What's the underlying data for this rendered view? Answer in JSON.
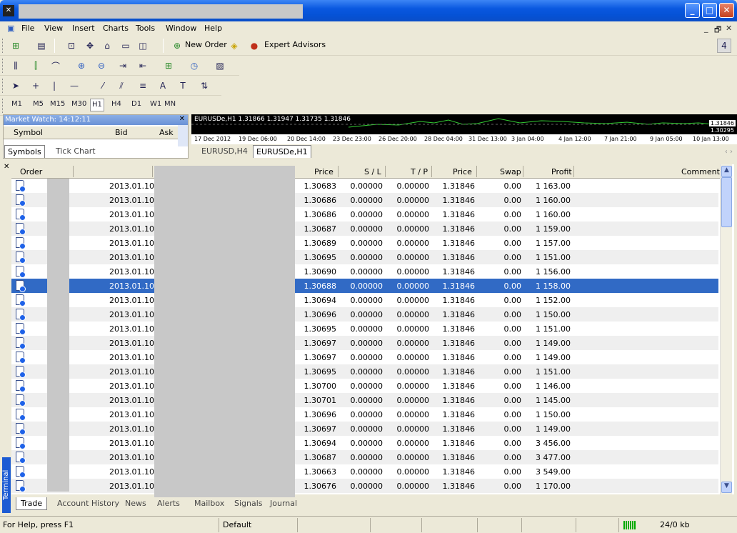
{
  "menu": [
    "File",
    "View",
    "Insert",
    "Charts",
    "Tools",
    "Window",
    "Help"
  ],
  "toolbar": {
    "new_order": "New Order",
    "expert_advisors": "Expert Advisors",
    "text_tool": "A"
  },
  "timeframes": [
    "M1",
    "M5",
    "M15",
    "M30",
    "H1",
    "H4",
    "D1",
    "W1",
    "MN"
  ],
  "market_watch": {
    "title": "Market Watch: 14:12:11",
    "col_symbol": "Symbol",
    "col_bid": "Bid",
    "col_ask": "Ask",
    "tabs": [
      "Symbols",
      "Tick Chart"
    ]
  },
  "chart": {
    "header": "EURUSDe,H1  1.31866 1.31947 1.31735 1.31846",
    "price_high": "1.31846",
    "price_low": "1.30295",
    "time_labels": [
      "17 Dec 2012",
      "19 Dec 06:00",
      "20 Dec 14:00",
      "23 Dec 23:00",
      "26 Dec 20:00",
      "28 Dec 04:00",
      "31 Dec 13:00",
      "3 Jan 04:00",
      "4 Jan 12:00",
      "7 Jan 21:00",
      "9 Jan 05:00",
      "10 Jan 13:00"
    ],
    "tabs": [
      "EURUSD,H4",
      "EURUSDe,H1"
    ]
  },
  "terminal": {
    "label": "Terminal",
    "columns": {
      "order": "Order",
      "price": "Price",
      "sl": "S / L",
      "tp": "T / P",
      "price2": "Price",
      "swap": "Swap",
      "profit": "Profit",
      "comment": "Comment"
    },
    "rows": [
      {
        "date": "2013.01.10",
        "price": "1.30683",
        "sl": "0.00000",
        "tp": "0.00000",
        "cur": "1.31846",
        "swap": "0.00",
        "profit": "1 163.00"
      },
      {
        "date": "2013.01.10",
        "price": "1.30686",
        "sl": "0.00000",
        "tp": "0.00000",
        "cur": "1.31846",
        "swap": "0.00",
        "profit": "1 160.00"
      },
      {
        "date": "2013.01.10",
        "price": "1.30686",
        "sl": "0.00000",
        "tp": "0.00000",
        "cur": "1.31846",
        "swap": "0.00",
        "profit": "1 160.00"
      },
      {
        "date": "2013.01.10",
        "price": "1.30687",
        "sl": "0.00000",
        "tp": "0.00000",
        "cur": "1.31846",
        "swap": "0.00",
        "profit": "1 159.00"
      },
      {
        "date": "2013.01.10",
        "price": "1.30689",
        "sl": "0.00000",
        "tp": "0.00000",
        "cur": "1.31846",
        "swap": "0.00",
        "profit": "1 157.00"
      },
      {
        "date": "2013.01.10",
        "price": "1.30695",
        "sl": "0.00000",
        "tp": "0.00000",
        "cur": "1.31846",
        "swap": "0.00",
        "profit": "1 151.00"
      },
      {
        "date": "2013.01.10",
        "price": "1.30690",
        "sl": "0.00000",
        "tp": "0.00000",
        "cur": "1.31846",
        "swap": "0.00",
        "profit": "1 156.00"
      },
      {
        "date": "2013.01.10",
        "price": "1.30688",
        "sl": "0.00000",
        "tp": "0.00000",
        "cur": "1.31846",
        "swap": "0.00",
        "profit": "1 158.00",
        "selected": true
      },
      {
        "date": "2013.01.10",
        "price": "1.30694",
        "sl": "0.00000",
        "tp": "0.00000",
        "cur": "1.31846",
        "swap": "0.00",
        "profit": "1 152.00"
      },
      {
        "date": "2013.01.10",
        "price": "1.30696",
        "sl": "0.00000",
        "tp": "0.00000",
        "cur": "1.31846",
        "swap": "0.00",
        "profit": "1 150.00"
      },
      {
        "date": "2013.01.10",
        "price": "1.30695",
        "sl": "0.00000",
        "tp": "0.00000",
        "cur": "1.31846",
        "swap": "0.00",
        "profit": "1 151.00"
      },
      {
        "date": "2013.01.10",
        "price": "1.30697",
        "sl": "0.00000",
        "tp": "0.00000",
        "cur": "1.31846",
        "swap": "0.00",
        "profit": "1 149.00"
      },
      {
        "date": "2013.01.10",
        "price": "1.30697",
        "sl": "0.00000",
        "tp": "0.00000",
        "cur": "1.31846",
        "swap": "0.00",
        "profit": "1 149.00"
      },
      {
        "date": "2013.01.10",
        "price": "1.30695",
        "sl": "0.00000",
        "tp": "0.00000",
        "cur": "1.31846",
        "swap": "0.00",
        "profit": "1 151.00"
      },
      {
        "date": "2013.01.10",
        "price": "1.30700",
        "sl": "0.00000",
        "tp": "0.00000",
        "cur": "1.31846",
        "swap": "0.00",
        "profit": "1 146.00"
      },
      {
        "date": "2013.01.10",
        "price": "1.30701",
        "sl": "0.00000",
        "tp": "0.00000",
        "cur": "1.31846",
        "swap": "0.00",
        "profit": "1 145.00"
      },
      {
        "date": "2013.01.10",
        "price": "1.30696",
        "sl": "0.00000",
        "tp": "0.00000",
        "cur": "1.31846",
        "swap": "0.00",
        "profit": "1 150.00"
      },
      {
        "date": "2013.01.10",
        "price": "1.30697",
        "sl": "0.00000",
        "tp": "0.00000",
        "cur": "1.31846",
        "swap": "0.00",
        "profit": "1 149.00"
      },
      {
        "date": "2013.01.10",
        "price": "1.30694",
        "sl": "0.00000",
        "tp": "0.00000",
        "cur": "1.31846",
        "swap": "0.00",
        "profit": "3 456.00"
      },
      {
        "date": "2013.01.10",
        "price": "1.30687",
        "sl": "0.00000",
        "tp": "0.00000",
        "cur": "1.31846",
        "swap": "0.00",
        "profit": "3 477.00"
      },
      {
        "date": "2013.01.10",
        "price": "1.30663",
        "sl": "0.00000",
        "tp": "0.00000",
        "cur": "1.31846",
        "swap": "0.00",
        "profit": "3 549.00"
      },
      {
        "date": "2013.01.10",
        "price": "1.30676",
        "sl": "0.00000",
        "tp": "0.00000",
        "cur": "1.31846",
        "swap": "0.00",
        "profit": "1 170.00"
      }
    ],
    "tabs": [
      "Trade",
      "Account History",
      "News",
      "Alerts",
      "Mailbox",
      "Signals",
      "Journal"
    ]
  },
  "status": {
    "help": "For Help, press F1",
    "profile": "Default",
    "traffic": "24/0 kb"
  }
}
